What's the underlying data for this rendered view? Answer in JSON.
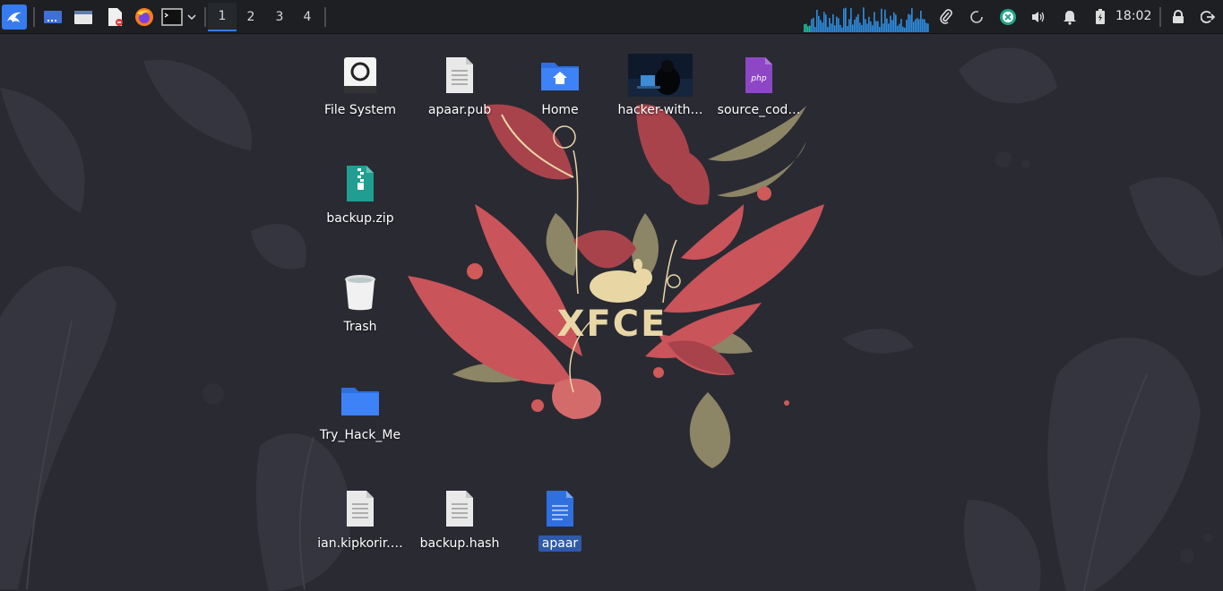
{
  "panel": {
    "launchers": [
      {
        "name": "app-menu-button",
        "icon": "kali-dragon-icon"
      },
      {
        "name": "show-desktop-button",
        "icon": "desktop-icon"
      },
      {
        "name": "file-manager-launcher",
        "icon": "folder-icon"
      },
      {
        "name": "text-editor-launcher",
        "icon": "text-editor-icon"
      },
      {
        "name": "firefox-launcher",
        "icon": "firefox-icon"
      },
      {
        "name": "terminal-launcher",
        "icon": "terminal-icon"
      }
    ],
    "workspaces": [
      "1",
      "2",
      "3",
      "4"
    ],
    "active_workspace": "1",
    "clock": "18:02",
    "tray": [
      "paperclip-icon",
      "spinner-icon",
      "update-icon",
      "volume-icon",
      "bell-icon",
      "battery-icon",
      "lock-icon",
      "logout-icon"
    ]
  },
  "desktop": {
    "icons": [
      {
        "label": "File System",
        "icon": "drive-icon"
      },
      {
        "label": "apaar.pub",
        "icon": "text-file-icon"
      },
      {
        "label": "Home",
        "icon": "home-folder-icon"
      },
      {
        "label": "hacker-with…",
        "icon": "image-thumbnail-icon"
      },
      {
        "label": "source_cod…",
        "icon": "php-file-icon"
      },
      {
        "label": "backup.zip",
        "icon": "zip-file-icon"
      },
      {
        "label": "Trash",
        "icon": "trash-icon"
      },
      {
        "label": "Try_Hack_Me",
        "icon": "folder-icon"
      },
      {
        "label": "ian.kipkorir.…",
        "icon": "text-file-icon"
      },
      {
        "label": "backup.hash",
        "icon": "text-file-icon"
      },
      {
        "label": "apaar",
        "icon": "document-icon"
      }
    ],
    "selected": "apaar",
    "wallpaper_text": "XFCE"
  },
  "colors": {
    "accent": "#367bf0",
    "desktop_bg": "#2a2a33",
    "panel_bg": "#1d1f23",
    "leaf_red": "#c9545a",
    "leaf_olive": "#8c8566",
    "mouse_cream": "#e8d7a5"
  }
}
